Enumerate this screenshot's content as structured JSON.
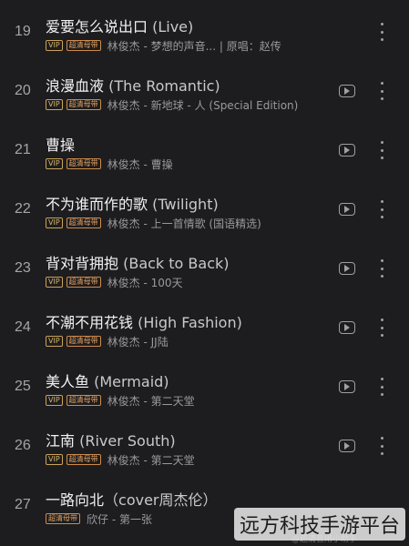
{
  "badges": {
    "vip": "VIP",
    "hq": "超清母带"
  },
  "songs": [
    {
      "num": "19",
      "title_cn": "爱要怎么说出口",
      "title_en": "(Live)",
      "meta": "林俊杰 - 梦想的声音... | 原唱：赵传",
      "has_mv": false,
      "has_vip": true
    },
    {
      "num": "20",
      "title_cn": "浪漫血液",
      "title_en": "(The Romantic)",
      "meta": "林俊杰 - 新地球 - 人 (Special Edition)",
      "has_mv": true,
      "has_vip": true
    },
    {
      "num": "21",
      "title_cn": "曹操",
      "title_en": "",
      "meta": "林俊杰 - 曹操",
      "has_mv": true,
      "has_vip": true
    },
    {
      "num": "22",
      "title_cn": "不为谁而作的歌",
      "title_en": "(Twilight)",
      "meta": "林俊杰 - 上一首情歌 (国语精选)",
      "has_mv": true,
      "has_vip": true
    },
    {
      "num": "23",
      "title_cn": "背对背拥抱",
      "title_en": "(Back to Back)",
      "meta": "林俊杰 - 100天",
      "has_mv": true,
      "has_vip": true
    },
    {
      "num": "24",
      "title_cn": "不潮不用花钱",
      "title_en": "(High Fashion)",
      "meta": "林俊杰 - JJ陆",
      "has_mv": true,
      "has_vip": true
    },
    {
      "num": "25",
      "title_cn": "美人鱼",
      "title_en": "(Mermaid)",
      "meta": "林俊杰 - 第二天堂",
      "has_mv": true,
      "has_vip": true
    },
    {
      "num": "26",
      "title_cn": "江南",
      "title_en": "(River South)",
      "meta": "林俊杰 - 第二天堂",
      "has_mv": true,
      "has_vip": true
    },
    {
      "num": "27",
      "title_cn": "一路向北",
      "title_en": "（cover周杰伦）",
      "meta": "欣仔 - 第一张",
      "has_mv": false,
      "has_vip": false
    }
  ],
  "watermark": {
    "main": "远方科技手游平台",
    "small": "@超清音用小助手"
  }
}
